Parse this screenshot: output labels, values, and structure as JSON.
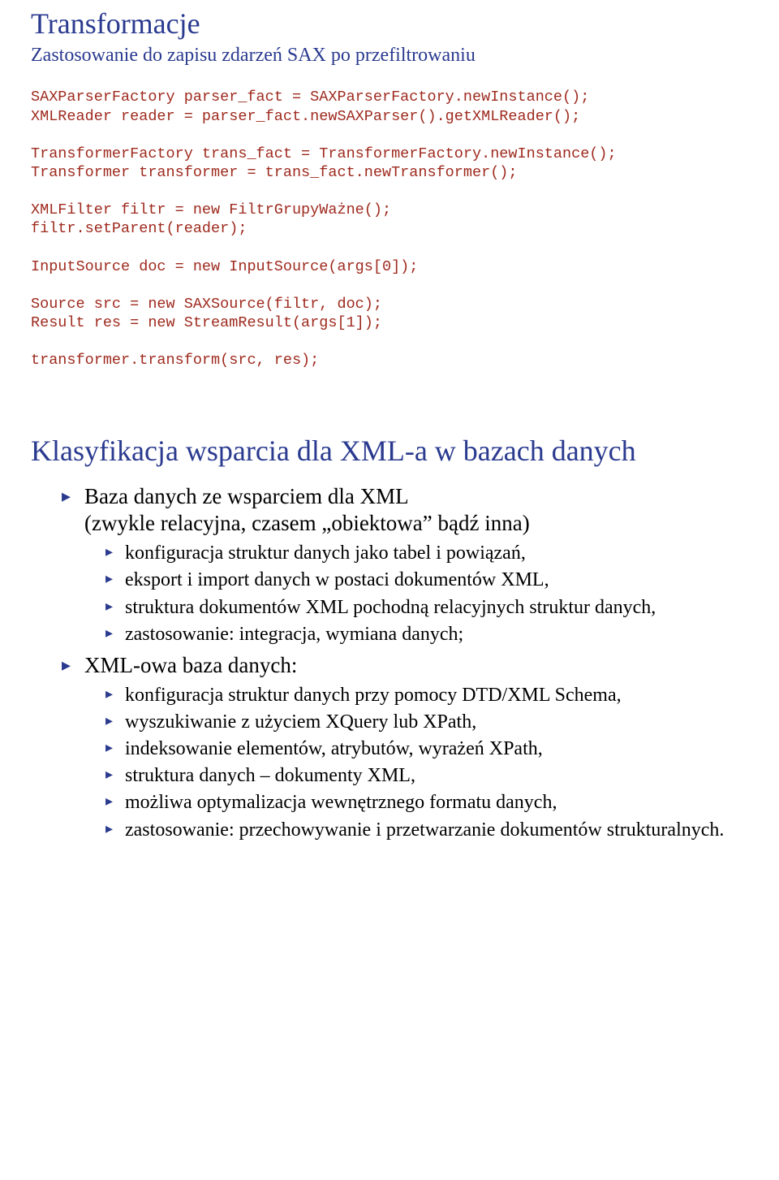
{
  "slide1": {
    "title": "Transformacje",
    "subtitle": "Zastosowanie do zapisu zdarzeń SAX po przefiltrowaniu",
    "code": "SAXParserFactory parser_fact = SAXParserFactory.newInstance();\nXMLReader reader = parser_fact.newSAXParser().getXMLReader();\n\nTransformerFactory trans_fact = TransformerFactory.newInstance();\nTransformer transformer = trans_fact.newTransformer();\n\nXMLFilter filtr = new FiltrGrupyWażne();\nfiltr.setParent(reader);\n\nInputSource doc = new InputSource(args[0]);\n\nSource src = new SAXSource(filtr, doc);\nResult res = new StreamResult(args[1]);\n\ntransformer.transform(src, res);"
  },
  "slide2": {
    "title": "Klasyfikacja wsparcia dla XML-a w bazach danych",
    "items": [
      {
        "text": "Baza danych ze wsparciem dla XML",
        "subtext": "(zwykle relacyjna, czasem „obiektowa” bądź inna)",
        "children": [
          "konfiguracja struktur danych jako tabel i powiązań,",
          "eksport i import danych w postaci dokumentów XML,",
          "struktura dokumentów XML pochodną relacyjnych struktur danych,",
          "zastosowanie: integracja, wymiana danych;"
        ]
      },
      {
        "text": "XML-owa baza danych:",
        "children": [
          "konfiguracja struktur danych przy pomocy DTD/XML Schema,",
          "wyszukiwanie z użyciem XQuery lub XPath,",
          "indeksowanie elementów, atrybutów, wyrażeń XPath,",
          "struktura danych – dokumenty XML,",
          "możliwa optymalizacja wewnętrznego formatu danych,",
          "zastosowanie: przechowywanie i przetwarzanie dokumentów strukturalnych."
        ]
      }
    ]
  }
}
